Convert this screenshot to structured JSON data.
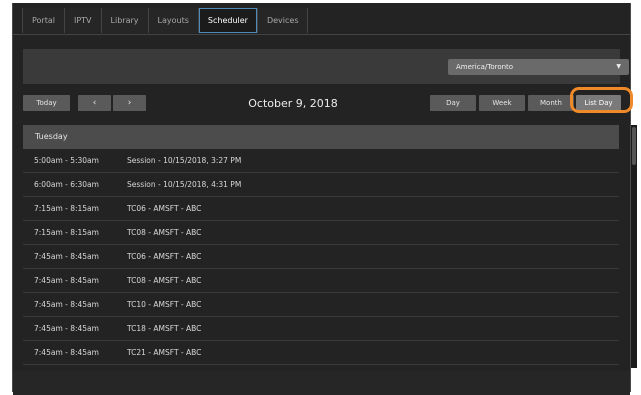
{
  "nav": {
    "tabs": [
      {
        "label": "Portal"
      },
      {
        "label": "IPTV"
      },
      {
        "label": "Library"
      },
      {
        "label": "Layouts"
      },
      {
        "label": "Scheduler"
      },
      {
        "label": "Devices"
      }
    ],
    "active": "Scheduler"
  },
  "timezone": {
    "value": "America/Toronto",
    "caret_icon": "chevron-down-icon"
  },
  "toolbar": {
    "today": "Today",
    "prev_icon": "chevron-left-icon",
    "next_icon": "chevron-right-icon",
    "title": "October 9, 2018",
    "views": [
      {
        "label": "Day"
      },
      {
        "label": "Week"
      },
      {
        "label": "Month"
      },
      {
        "label": "List Day"
      }
    ],
    "selected_view": "List Day",
    "highlight_color": "#ef8a2a"
  },
  "list": {
    "day_label": "Tuesday",
    "rows": [
      {
        "time": "5:00am - 5:30am",
        "event": "Session - 10/15/2018, 3:27 PM"
      },
      {
        "time": "6:00am - 6:30am",
        "event": "Session - 10/15/2018, 4:31 PM"
      },
      {
        "time": "7:15am - 8:15am",
        "event": "TC06 - AMSFT - ABC"
      },
      {
        "time": "7:15am - 8:15am",
        "event": "TC08 - AMSFT - ABC"
      },
      {
        "time": "7:45am - 8:45am",
        "event": "TC06 - AMSFT - ABC"
      },
      {
        "time": "7:45am - 8:45am",
        "event": "TC08 - AMSFT - ABC"
      },
      {
        "time": "7:45am - 8:45am",
        "event": "TC10 - AMSFT - ABC"
      },
      {
        "time": "7:45am - 8:45am",
        "event": "TC18 - AMSFT - ABC"
      },
      {
        "time": "7:45am - 8:45am",
        "event": "TC21 - AMSFT - ABC"
      }
    ]
  }
}
